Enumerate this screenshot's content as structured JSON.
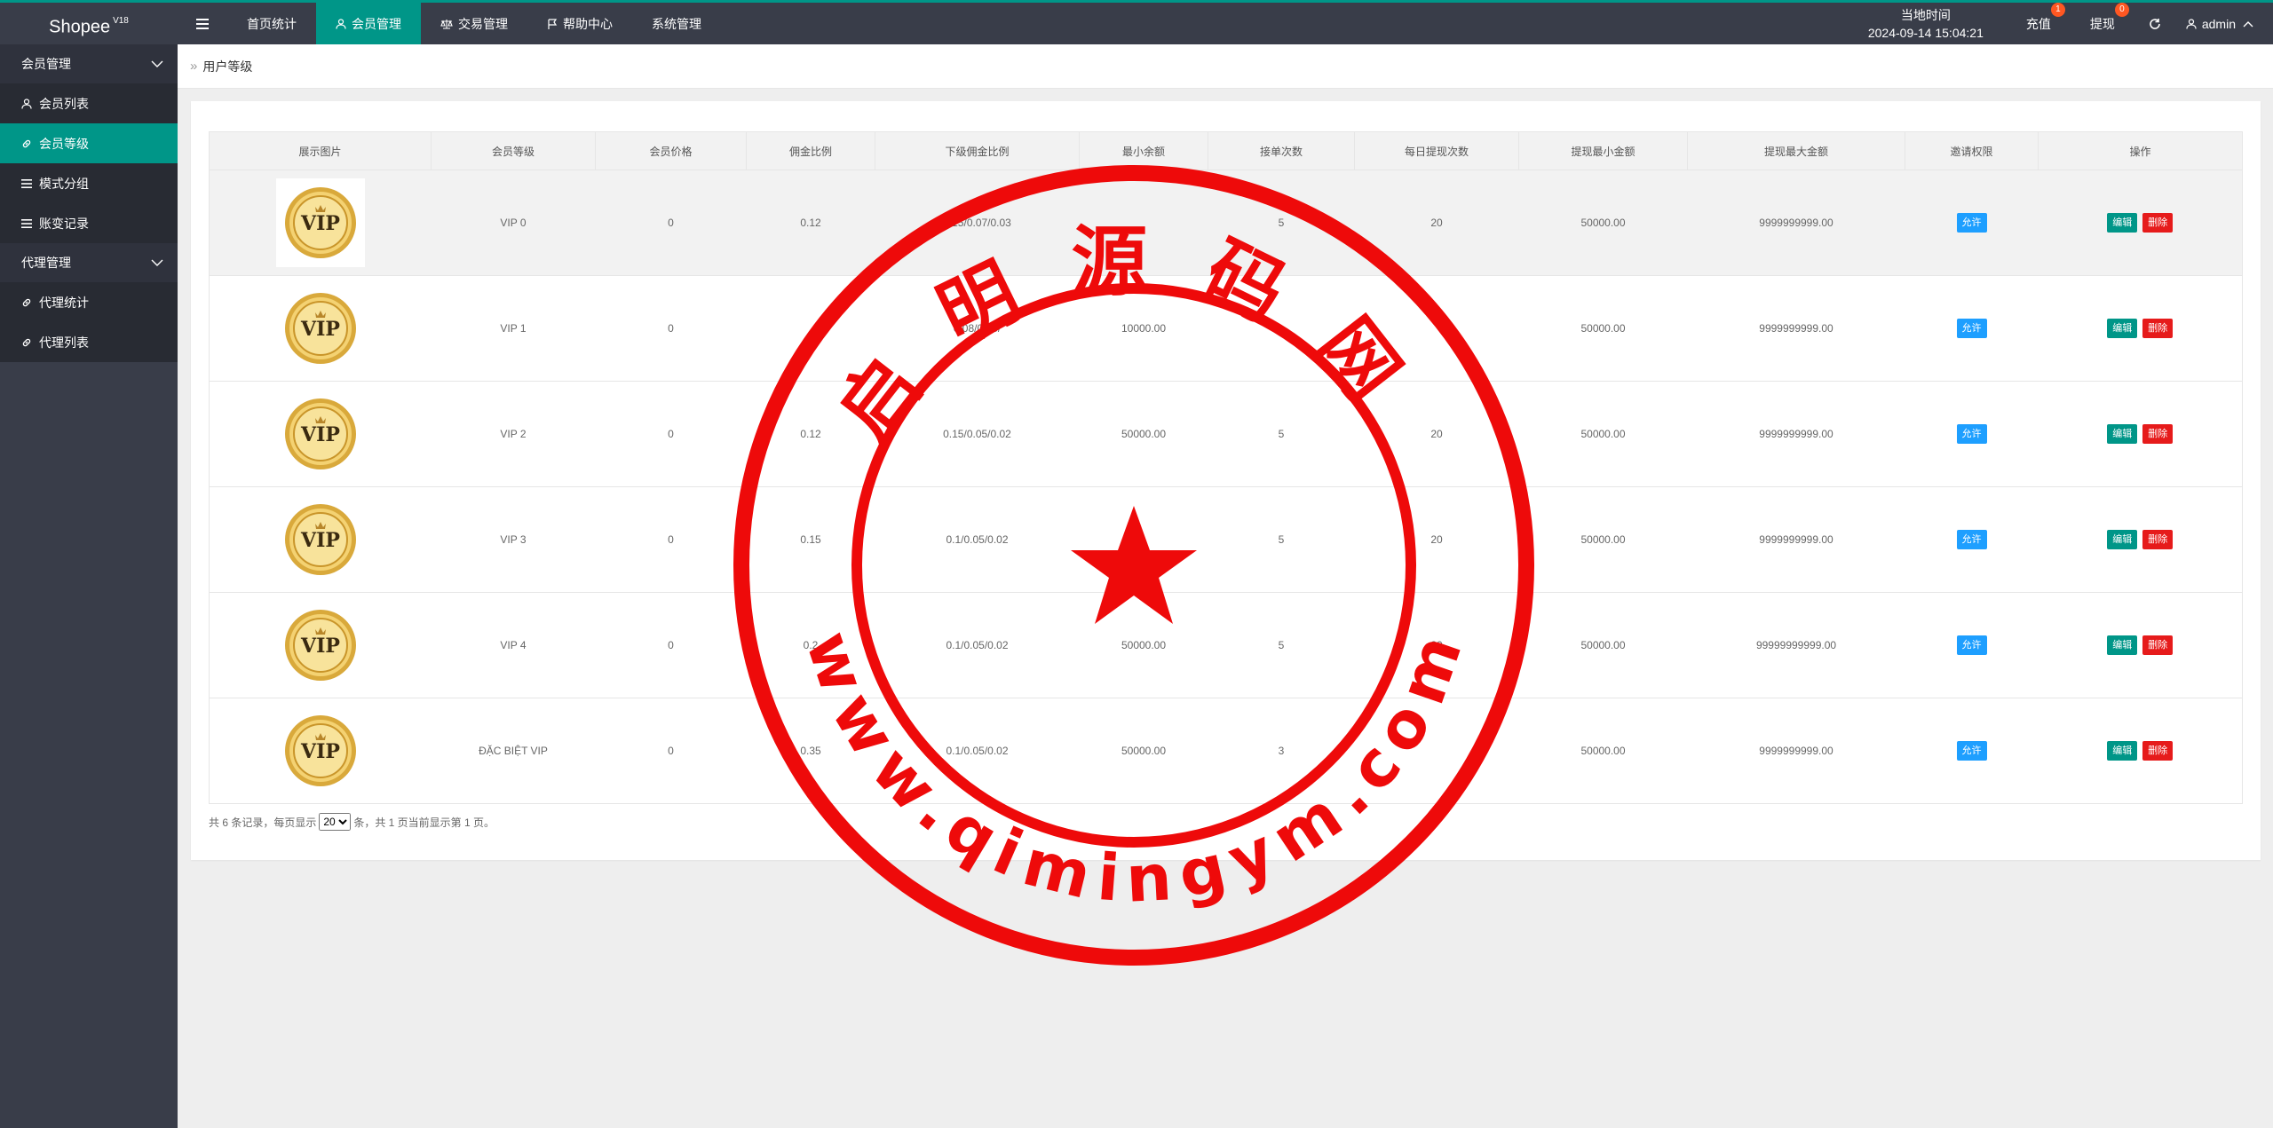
{
  "header": {
    "logo": "Shopee",
    "logo_version": "V18",
    "nav": [
      "首页统计",
      "会员管理",
      "交易管理",
      "帮助中心",
      "系统管理"
    ],
    "time_label": "当地时间",
    "time_value": "2024-09-14 15:04:21",
    "recharge_label": "充值",
    "recharge_badge": "1",
    "withdraw_label": "提现",
    "withdraw_badge": "0",
    "user": "admin"
  },
  "sidebar": {
    "group1": "会员管理",
    "group1_items": [
      "会员列表",
      "会员等级",
      "模式分组",
      "账变记录"
    ],
    "group2": "代理管理",
    "group2_items": [
      "代理统计",
      "代理列表"
    ]
  },
  "breadcrumb": "用户等级",
  "table": {
    "headers": [
      "展示图片",
      "会员等级",
      "会员价格",
      "佣金比例",
      "下级佣金比例",
      "最小余额",
      "接单次数",
      "每日提现次数",
      "提现最小金额",
      "提现最大金额",
      "邀请权限",
      "操作"
    ],
    "rows": [
      {
        "level": "VIP 0",
        "price": "0",
        "commission": "0.12",
        "sub_commission": "0.15/0.07/0.03",
        "min_balance": "",
        "orders": "5",
        "daily_withdraw": "20",
        "wd_min": "50000.00",
        "wd_max": "9999999999.00"
      },
      {
        "level": "VIP 1",
        "price": "0",
        "commission": "",
        "sub_commission": "0.08/0.05/",
        "min_balance": "10000.00",
        "orders": "",
        "daily_withdraw": "",
        "wd_min": "50000.00",
        "wd_max": "9999999999.00"
      },
      {
        "level": "VIP 2",
        "price": "0",
        "commission": "0.12",
        "sub_commission": "0.15/0.05/0.02",
        "min_balance": "50000.00",
        "orders": "5",
        "daily_withdraw": "20",
        "wd_min": "50000.00",
        "wd_max": "9999999999.00"
      },
      {
        "level": "VIP 3",
        "price": "0",
        "commission": "0.15",
        "sub_commission": "0.1/0.05/0.02",
        "min_balance": "",
        "orders": "5",
        "daily_withdraw": "20",
        "wd_min": "50000.00",
        "wd_max": "9999999999.00"
      },
      {
        "level": "VIP 4",
        "price": "0",
        "commission": "0.2",
        "sub_commission": "0.1/0.05/0.02",
        "min_balance": "50000.00",
        "orders": "5",
        "daily_withdraw": "20",
        "wd_min": "50000.00",
        "wd_max": "99999999999.00"
      },
      {
        "level": "ĐẶC BIỆT VIP",
        "price": "0",
        "commission": "0.35",
        "sub_commission": "0.1/0.05/0.02",
        "min_balance": "50000.00",
        "orders": "3",
        "daily_withdraw": "",
        "wd_min": "50000.00",
        "wd_max": "9999999999.00"
      }
    ],
    "vip_badge_text": "VIP",
    "allow_label": "允许",
    "edit_label": "编辑",
    "delete_label": "删除"
  },
  "pager": {
    "prefix": "共 6 条记录，每页显示",
    "per_page": "20",
    "suffix": "条，共 1 页当前显示第 1 页。"
  },
  "watermark": {
    "top_text": [
      "启",
      "明",
      "源",
      "码",
      "网"
    ],
    "bottom_text": "www.qimingym.com",
    "color": "#ee0a0a"
  },
  "colors": {
    "accent": "#009688",
    "header": "#393d49",
    "blue": "#1e9fff",
    "danger": "#e61b1b"
  }
}
